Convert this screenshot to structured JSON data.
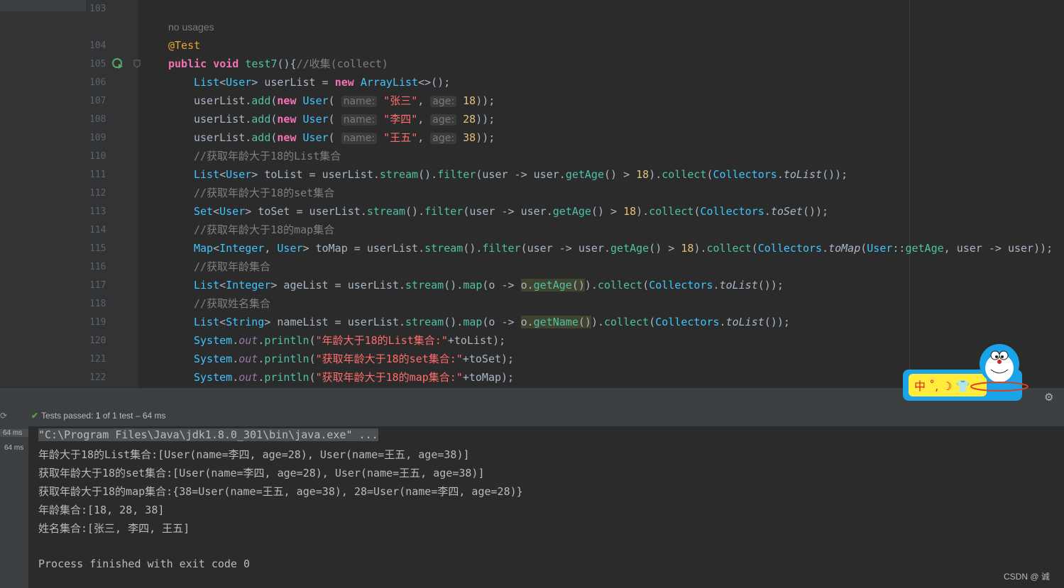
{
  "editor": {
    "no_usages": "no usages",
    "line_numbers": [
      "103",
      "104",
      "105",
      "106",
      "107",
      "108",
      "109",
      "110",
      "111",
      "112",
      "113",
      "114",
      "115",
      "116",
      "117",
      "118",
      "119",
      "120",
      "121",
      "122"
    ],
    "lines": {
      "l104_annotation": "@Test",
      "l105": {
        "public": "public",
        "void": "void",
        "method": "test7",
        "rest": "(){",
        "comment": "//收集(collect)"
      },
      "l106": {
        "t1": "List",
        "t2": "User",
        "var": "userList",
        "new": "new",
        "t3": "ArrayList",
        "rest": "<>();"
      },
      "l107": {
        "name_val": "\"张三\"",
        "age_val": "18"
      },
      "l108": {
        "name_val": "\"李四\"",
        "age_val": "28"
      },
      "l109": {
        "name_val": "\"王五\"",
        "age_val": "38"
      },
      "hint_name": "name:",
      "hint_age": "age:",
      "c110": "//获取年龄大于18的List集合",
      "c112": "//获取年龄大于18的set集合",
      "c114": "//获取年龄大于18的map集合",
      "c116": "//获取年龄集合",
      "c118": "//获取姓名集合",
      "s120": "\"年龄大于18的List集合:\"",
      "s121": "\"获取年龄大于18的set集合:\"",
      "s122": "\"获取年龄大于18的map集合:\""
    }
  },
  "mascot_text": "中 ˚, ☽ 👕",
  "run_panel": {
    "status_prefix": "Tests passed:",
    "passed": "1",
    "of_text": "of 1 test",
    "duration": "– 64 ms",
    "tree_times": [
      "64 ms",
      "64 ms"
    ]
  },
  "console": {
    "cmd": "\"C:\\Program Files\\Java\\jdk1.8.0_301\\bin\\java.exe\" ...",
    "lines": [
      "年龄大于18的List集合:[User(name=李四, age=28), User(name=王五, age=38)]",
      "获取年龄大于18的set集合:[User(name=李四, age=28), User(name=王五, age=38)]",
      "获取年龄大于18的map集合:{38=User(name=王五, age=38), 28=User(name=李四, age=28)}",
      "年龄集合:[18, 28, 38]",
      "姓名集合:[张三, 李四, 王五]",
      "",
      "Process finished with exit code 0"
    ]
  },
  "watermark": "CSDN @ 诚",
  "colors": {
    "keyword": "#f472b6",
    "type": "#40c4ff",
    "string": "#ff6e6e",
    "comment": "#808080",
    "pass": "#5aa04b"
  }
}
